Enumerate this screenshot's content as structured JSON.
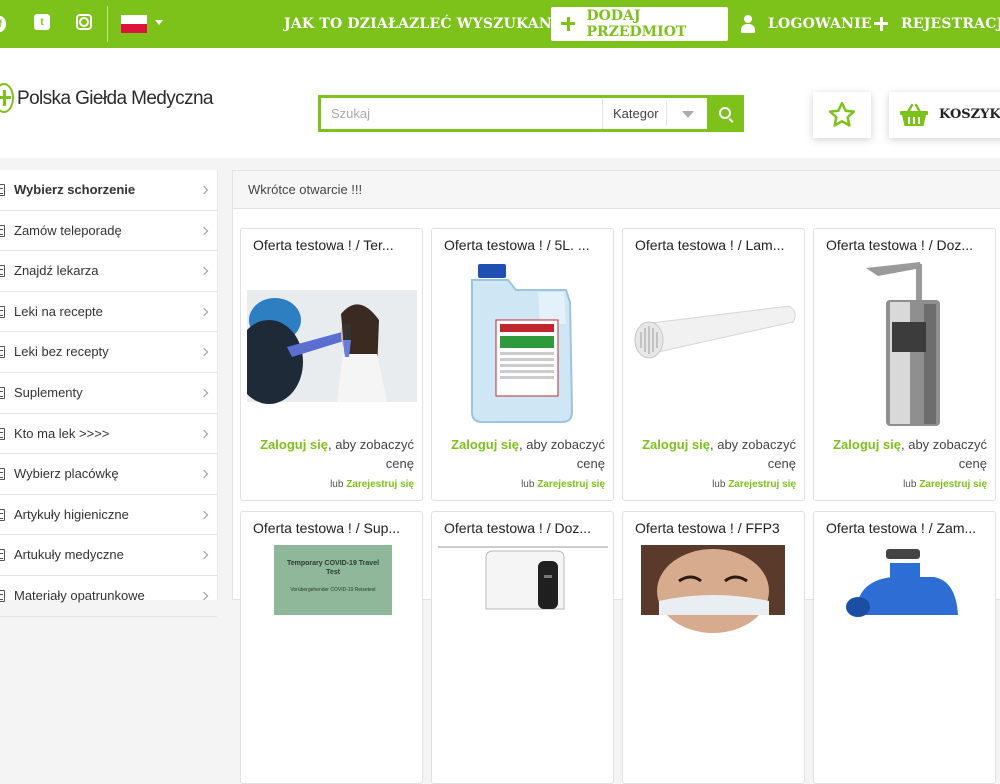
{
  "topbar": {
    "social": [
      "facebook-icon",
      "twitter-icon",
      "instagram-icon"
    ],
    "language": "pl-flag-icon",
    "nav": {
      "how": "JAK TO DZIAŁA",
      "order": "ZLEĆ WYSZUKANIE",
      "add": "DODAJ PRZEDMIOT",
      "login": "LOGOWANIE",
      "register": "REJESTRACJA"
    }
  },
  "header": {
    "logo": "Polska Giełda Medyczna",
    "search": {
      "placeholder": "Szukaj",
      "value": "",
      "category": "Kategor"
    },
    "cart_label": "KOSZYK"
  },
  "sidebar": {
    "items": [
      {
        "label": "Wybierz schorzenie"
      },
      {
        "label": "Zamów teleporadę"
      },
      {
        "label": "Znajdź lekarza"
      },
      {
        "label": "Leki na recepte"
      },
      {
        "label": "Leki bez recepty"
      },
      {
        "label": "Suplementy"
      },
      {
        "label": "Kto ma lek >>>>"
      },
      {
        "label": "Wybierz placówkę"
      },
      {
        "label": "Artykuły higieniczne"
      },
      {
        "label": "Artukuły medyczne"
      },
      {
        "label": "Materiały opatrunkowe"
      }
    ]
  },
  "main": {
    "heading": "Wkrótce otwarcie !!!",
    "cards": [
      {
        "title": "Oferta testowa ! / Ter...",
        "image": "thermometer-photo"
      },
      {
        "title": "Oferta testowa ! / 5L. ...",
        "image": "canister-photo"
      },
      {
        "title": "Oferta testowa ! / Lam...",
        "image": "uv-lamp-photo"
      },
      {
        "title": "Oferta testowa ! / Doz...",
        "image": "dispenser-photo"
      },
      {
        "title": "Oferta testowa ! / Sup...",
        "image": "covid-test-photo"
      },
      {
        "title": "Oferta testowa ! / Doz...",
        "image": "auto-dispenser-photo"
      },
      {
        "title": "Oferta testowa ! / FFP3",
        "image": "mask-photo"
      },
      {
        "title": "Oferta testowa ! / Zam...",
        "image": "fogger-photo"
      }
    ],
    "card_text": {
      "login_link": "Zaloguj się",
      "login_rest": ", aby zobaczyć",
      "price_word": "cenę",
      "or": "lub ",
      "register_link": "Zarejestruj się"
    },
    "covid_box": {
      "title": "Temporary COVID-19 Travel Test",
      "sub": "Vorübergehender COVID-19 Reisetest"
    }
  },
  "colors": {
    "accent": "#7cc21b",
    "flag_red": "#dc143c"
  }
}
